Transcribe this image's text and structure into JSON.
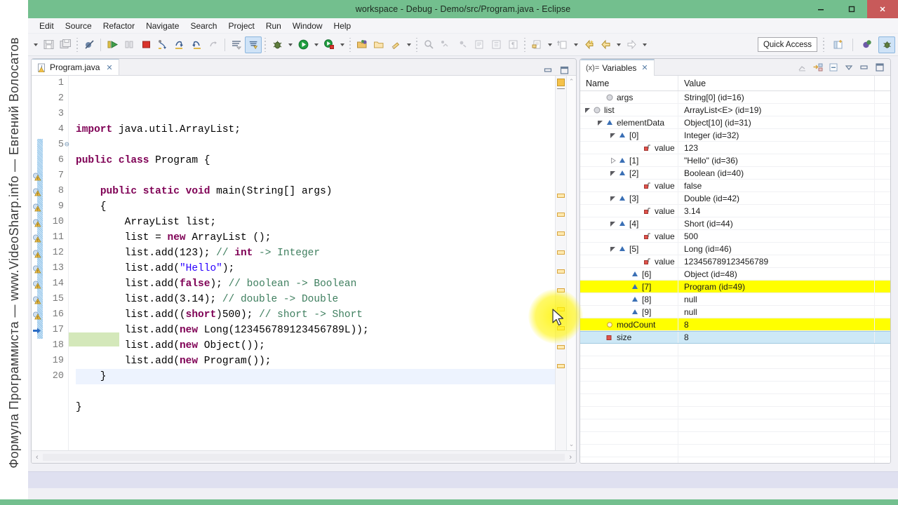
{
  "watermark": {
    "text": "Формула Программиста — www.VideoSharp.info — Евгений Волосатов"
  },
  "window": {
    "title": "workspace - Debug - Demo/src/Program.java - Eclipse",
    "minimize_label": "minimize-icon",
    "maximize_label": "maximize-icon",
    "close_label": "close-icon",
    "titlebar_color": "#73bf8e"
  },
  "menubar": {
    "items": [
      {
        "label": "Edit"
      },
      {
        "label": "Source"
      },
      {
        "label": "Refactor"
      },
      {
        "label": "Navigate"
      },
      {
        "label": "Search"
      },
      {
        "label": "Project"
      },
      {
        "label": "Run"
      },
      {
        "label": "Window"
      },
      {
        "label": "Help"
      }
    ]
  },
  "toolbar": {
    "quick_access": "Quick Access",
    "icons": [
      "dropdown-caret-icon",
      "save-icon",
      "save-all-icon",
      "toggle-breakpoints-icon",
      "resume-icon",
      "suspend-icon",
      "terminate-icon",
      "step-into-icon",
      "step-over-icon",
      "step-return-icon",
      "drop-to-frame-icon",
      "use-step-filters-icon",
      "skip-all-breakpoints-icon",
      "debug-icon",
      "run-icon",
      "run-external-tools-icon",
      "new-java-project-icon",
      "new-folder-icon",
      "new-java-class-icon",
      "search-icon",
      "print-icon",
      "refresh-icon",
      "externalize-strings-icon",
      "open-type-icon",
      "show-whitespace-icon",
      "open-task-icon",
      "next-annotation-icon",
      "previous-edit-icon",
      "back-icon",
      "forward-icon"
    ],
    "perspective_icons": [
      "open-perspective-icon",
      "java-perspective-icon",
      "debug-perspective-icon"
    ]
  },
  "editor": {
    "tab_label": "Program.java",
    "tab_close": "✕",
    "minimize": "minimize-view-icon",
    "maximize": "maximize-view-icon",
    "scroll_up": "scroll-up-icon",
    "scroll_down": "scroll-down-icon",
    "hscroll_left": "‹",
    "hscroll_right": "›",
    "lines": [
      {
        "n": 1,
        "tokens": [
          {
            "t": "import ",
            "c": "kw"
          },
          {
            "t": "java.util.ArrayList;",
            "c": "nm"
          }
        ]
      },
      {
        "n": 2,
        "tokens": []
      },
      {
        "n": 3,
        "tokens": [
          {
            "t": "public class ",
            "c": "kw"
          },
          {
            "t": "Program {",
            "c": "nm"
          }
        ]
      },
      {
        "n": 4,
        "tokens": []
      },
      {
        "n": 5,
        "tokens": [
          {
            "t": "    ",
            "c": "nm"
          },
          {
            "t": "public static void ",
            "c": "kw"
          },
          {
            "t": "main(String[] args)",
            "c": "nm"
          }
        ],
        "fold": true
      },
      {
        "n": 6,
        "tokens": [
          {
            "t": "    {",
            "c": "nm"
          }
        ]
      },
      {
        "n": 7,
        "tokens": [
          {
            "t": "        ArrayList list;",
            "c": "nm"
          }
        ],
        "warn": true
      },
      {
        "n": 8,
        "tokens": [
          {
            "t": "        list = ",
            "c": "nm"
          },
          {
            "t": "new ",
            "c": "kw"
          },
          {
            "t": "ArrayList ();",
            "c": "nm"
          }
        ],
        "warn": true
      },
      {
        "n": 9,
        "tokens": [
          {
            "t": "        list.add(123); ",
            "c": "nm"
          },
          {
            "t": "// ",
            "c": "cmt"
          },
          {
            "t": "int",
            "c": "kw"
          },
          {
            "t": " -> Integer",
            "c": "cmt"
          }
        ],
        "warn": true
      },
      {
        "n": 10,
        "tokens": [
          {
            "t": "        list.add(",
            "c": "nm"
          },
          {
            "t": "\"Hello\"",
            "c": "str"
          },
          {
            "t": ");",
            "c": "nm"
          }
        ],
        "warn": true
      },
      {
        "n": 11,
        "tokens": [
          {
            "t": "        list.add(",
            "c": "nm"
          },
          {
            "t": "false",
            "c": "kw"
          },
          {
            "t": "); ",
            "c": "nm"
          },
          {
            "t": "// boolean -> Boolean",
            "c": "cmt"
          }
        ],
        "warn": true
      },
      {
        "n": 12,
        "tokens": [
          {
            "t": "        list.add(3.14); ",
            "c": "nm"
          },
          {
            "t": "// double -> Double",
            "c": "cmt"
          }
        ],
        "warn": true
      },
      {
        "n": 13,
        "tokens": [
          {
            "t": "        list.add((",
            "c": "nm"
          },
          {
            "t": "short",
            "c": "kw"
          },
          {
            "t": ")500); ",
            "c": "nm"
          },
          {
            "t": "// short -> Short",
            "c": "cmt"
          }
        ],
        "warn": true
      },
      {
        "n": 14,
        "tokens": [
          {
            "t": "        list.add(",
            "c": "nm"
          },
          {
            "t": "new ",
            "c": "kw"
          },
          {
            "t": "Long(123456789123456789L));",
            "c": "nm"
          }
        ],
        "warn": true
      },
      {
        "n": 15,
        "tokens": [
          {
            "t": "        list.add(",
            "c": "nm"
          },
          {
            "t": "new ",
            "c": "kw"
          },
          {
            "t": "Object());",
            "c": "nm"
          }
        ],
        "warn": true
      },
      {
        "n": 16,
        "tokens": [
          {
            "t": "        list.add(",
            "c": "nm"
          },
          {
            "t": "new ",
            "c": "kw"
          },
          {
            "t": "Program());",
            "c": "nm"
          }
        ],
        "warn": true
      },
      {
        "n": 17,
        "tokens": [
          {
            "t": "    }",
            "c": "nm"
          }
        ],
        "current": true
      },
      {
        "n": 18,
        "tokens": []
      },
      {
        "n": 19,
        "tokens": [
          {
            "t": "}",
            "c": "nm"
          }
        ]
      },
      {
        "n": 20,
        "tokens": []
      }
    ]
  },
  "variables": {
    "tab_label": "Variables",
    "tab_prefix": "(x)=",
    "tab_close": "✕",
    "tools": [
      "collapse-expand-icon",
      "show-logical-structure-icon",
      "collapse-all-icon",
      "view-menu-icon",
      "minimize-view-icon",
      "maximize-view-icon"
    ],
    "columns": [
      "Name",
      "Value"
    ],
    "rows": [
      {
        "name": "args",
        "value": "String[0]  (id=16)",
        "indent": 1,
        "twisty": "none",
        "icon": "field-public-icon",
        "highlight": "none"
      },
      {
        "name": "list",
        "value": "ArrayList<E>  (id=19)",
        "indent": 0,
        "twisty": "expanded",
        "icon": "field-public-icon",
        "highlight": "none"
      },
      {
        "name": "elementData",
        "value": "Object[10]  (id=31)",
        "indent": 1,
        "twisty": "expanded",
        "icon": "field-private-icon",
        "highlight": "none"
      },
      {
        "name": "[0]",
        "value": "Integer  (id=32)",
        "indent": 2,
        "twisty": "expanded",
        "icon": "field-private-icon",
        "highlight": "none"
      },
      {
        "name": "value",
        "value": "123",
        "indent": 4,
        "twisty": "none",
        "icon": "field-final-icon",
        "highlight": "none"
      },
      {
        "name": "[1]",
        "value": "\"Hello\"  (id=36)",
        "indent": 2,
        "twisty": "collapsed",
        "icon": "field-private-icon",
        "highlight": "none"
      },
      {
        "name": "[2]",
        "value": "Boolean  (id=40)",
        "indent": 2,
        "twisty": "expanded",
        "icon": "field-private-icon",
        "highlight": "none"
      },
      {
        "name": "value",
        "value": "false",
        "indent": 4,
        "twisty": "none",
        "icon": "field-final-icon",
        "highlight": "none"
      },
      {
        "name": "[3]",
        "value": "Double  (id=42)",
        "indent": 2,
        "twisty": "expanded",
        "icon": "field-private-icon",
        "highlight": "none"
      },
      {
        "name": "value",
        "value": "3.14",
        "indent": 4,
        "twisty": "none",
        "icon": "field-final-icon",
        "highlight": "none"
      },
      {
        "name": "[4]",
        "value": "Short  (id=44)",
        "indent": 2,
        "twisty": "expanded",
        "icon": "field-private-icon",
        "highlight": "none"
      },
      {
        "name": "value",
        "value": "500",
        "indent": 4,
        "twisty": "none",
        "icon": "field-final-icon",
        "highlight": "none"
      },
      {
        "name": "[5]",
        "value": "Long  (id=46)",
        "indent": 2,
        "twisty": "expanded",
        "icon": "field-private-icon",
        "highlight": "none"
      },
      {
        "name": "value",
        "value": "123456789123456789",
        "indent": 4,
        "twisty": "none",
        "icon": "field-final-icon",
        "highlight": "none"
      },
      {
        "name": "[6]",
        "value": "Object  (id=48)",
        "indent": 3,
        "twisty": "none",
        "icon": "field-private-icon",
        "highlight": "none"
      },
      {
        "name": "[7]",
        "value": "Program  (id=49)",
        "indent": 3,
        "twisty": "none",
        "icon": "field-private-icon",
        "highlight": "yellow"
      },
      {
        "name": "[8]",
        "value": "null",
        "indent": 3,
        "twisty": "none",
        "icon": "field-private-icon",
        "highlight": "none"
      },
      {
        "name": "[9]",
        "value": "null",
        "indent": 3,
        "twisty": "none",
        "icon": "field-private-icon",
        "highlight": "none"
      },
      {
        "name": "modCount",
        "value": "8",
        "indent": 1,
        "twisty": "none",
        "icon": "field-protected-icon",
        "highlight": "yellow"
      },
      {
        "name": "size",
        "value": "8",
        "indent": 1,
        "twisty": "none",
        "icon": "field-private-red-icon",
        "highlight": "selected"
      }
    ],
    "empty_row_count": 12
  },
  "colors": {
    "accent_green": "#73bf8e",
    "highlight_yellow": "#ffff00",
    "selection_blue": "#cde8f6",
    "keyword": "#7f0055",
    "string": "#2a00ff",
    "comment": "#3f7f5f",
    "cursor_glow": "#fff400"
  }
}
